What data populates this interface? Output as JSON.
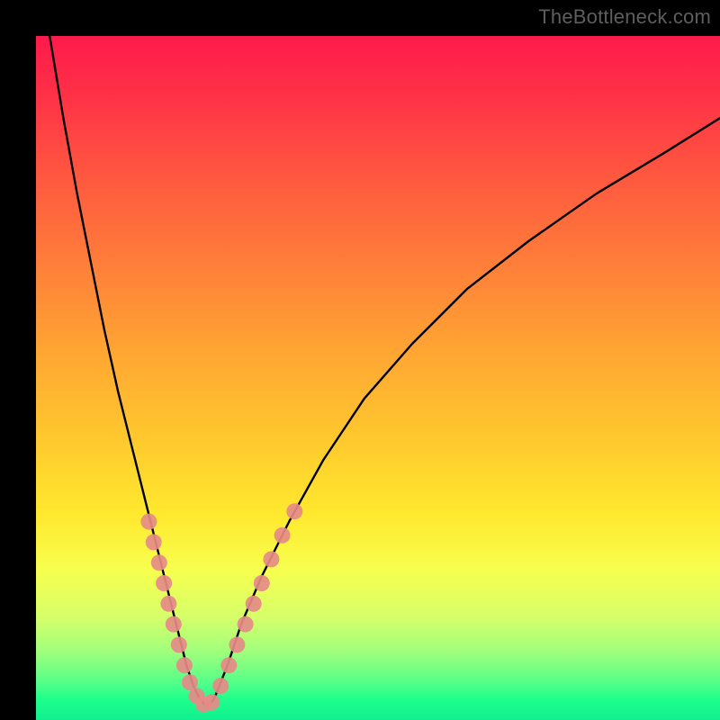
{
  "watermark": "TheBottleneck.com",
  "chart_data": {
    "type": "line",
    "title": "",
    "xlabel": "",
    "ylabel": "",
    "xlim": [
      0,
      100
    ],
    "ylim": [
      0,
      100
    ],
    "grid": false,
    "series": [
      {
        "name": "bottleneck-curve",
        "x": [
          2,
          4,
          6,
          8,
          10,
          12,
          14,
          16,
          18,
          19,
          20,
          21,
          22,
          23,
          24,
          25,
          26,
          28,
          30,
          33,
          37,
          42,
          48,
          55,
          63,
          72,
          82,
          92,
          100
        ],
        "y": [
          100,
          88,
          77,
          67,
          57,
          48,
          40,
          32,
          24,
          20,
          16,
          12,
          8,
          5,
          3,
          2,
          3,
          8,
          14,
          21,
          29,
          38,
          47,
          55,
          63,
          70,
          77,
          83,
          88
        ]
      }
    ],
    "markers": [
      {
        "x": 16.5,
        "y": 29
      },
      {
        "x": 17.2,
        "y": 26
      },
      {
        "x": 18.0,
        "y": 23
      },
      {
        "x": 18.7,
        "y": 20
      },
      {
        "x": 19.4,
        "y": 17
      },
      {
        "x": 20.1,
        "y": 14
      },
      {
        "x": 20.9,
        "y": 11
      },
      {
        "x": 21.7,
        "y": 8
      },
      {
        "x": 22.5,
        "y": 5.5
      },
      {
        "x": 23.5,
        "y": 3.5
      },
      {
        "x": 24.5,
        "y": 2.3
      },
      {
        "x": 25.7,
        "y": 2.6
      },
      {
        "x": 27.0,
        "y": 5
      },
      {
        "x": 28.2,
        "y": 8
      },
      {
        "x": 29.4,
        "y": 11
      },
      {
        "x": 30.6,
        "y": 14
      },
      {
        "x": 31.8,
        "y": 17
      },
      {
        "x": 33.0,
        "y": 20
      },
      {
        "x": 34.4,
        "y": 23.5
      },
      {
        "x": 36.0,
        "y": 27
      },
      {
        "x": 37.8,
        "y": 30.5
      }
    ],
    "background_gradient": {
      "top": "#ff1a4b",
      "mid": "#ffe92e",
      "bottom": "#10f090"
    }
  }
}
